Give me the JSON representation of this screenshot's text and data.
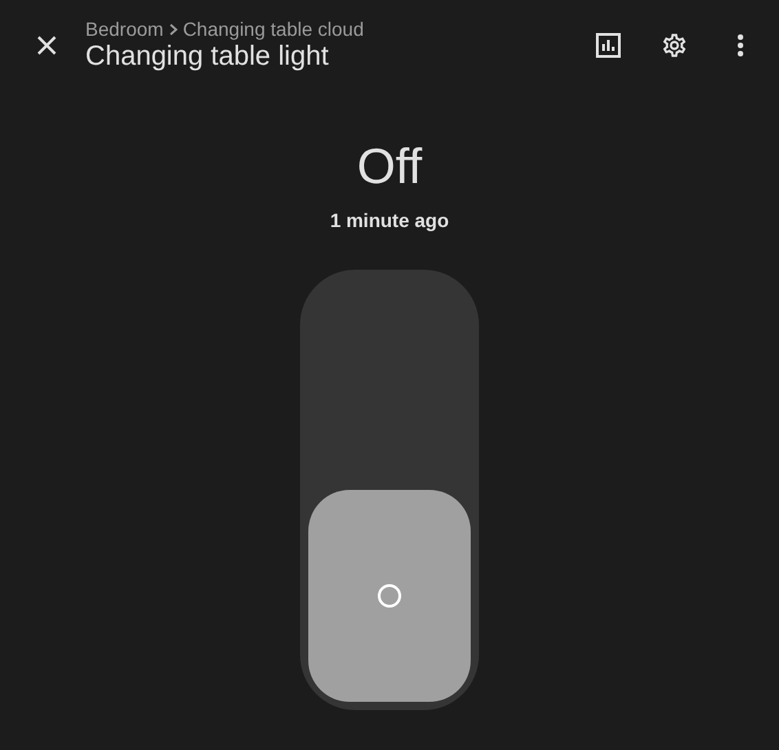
{
  "header": {
    "breadcrumb": [
      "Bedroom",
      "Changing table cloud"
    ],
    "title": "Changing table light"
  },
  "state": {
    "label": "Off",
    "last_changed": "1 minute ago"
  },
  "toggle": {
    "on": false
  }
}
